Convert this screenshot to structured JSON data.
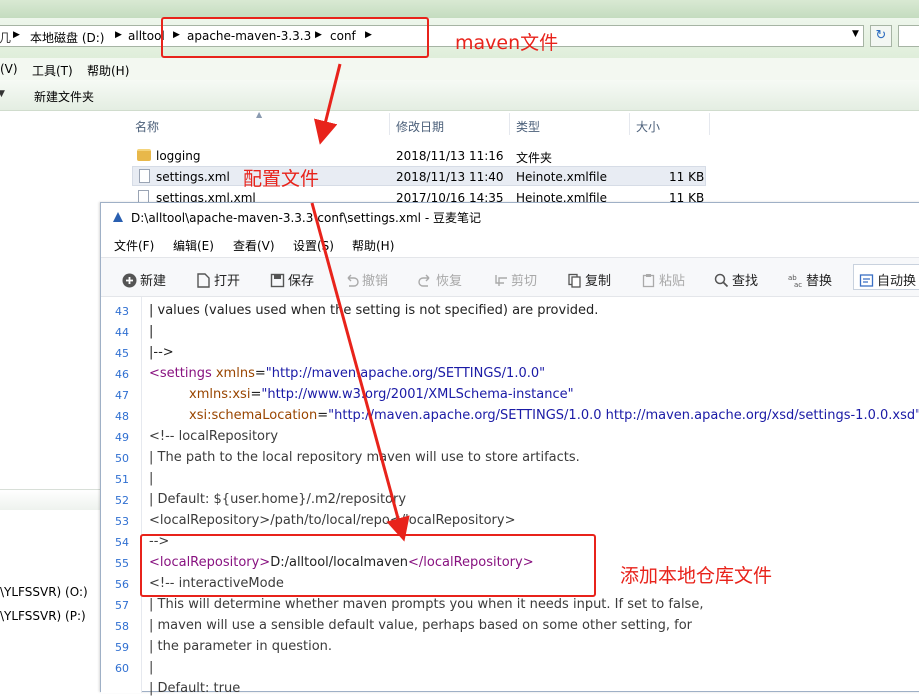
{
  "explorer": {
    "breadcrumbs": [
      "本地磁盘 (D:)",
      "alltool",
      "apache-maven-3.3.3",
      "conf"
    ],
    "menu": [
      "(V)",
      "工具(T)",
      "帮助(H)"
    ],
    "toolbar": {
      "new_folder": "新建文件夹"
    },
    "columns": {
      "name": "名称",
      "modified": "修改日期",
      "type": "类型",
      "size": "大小"
    },
    "files": [
      {
        "name": "logging",
        "modified": "2018/11/13 11:16",
        "type": "文件夹",
        "size": "",
        "kind": "folder"
      },
      {
        "name": "settings.xml",
        "modified": "2018/11/13 11:40",
        "type": "Heinote.xmlfile",
        "size": "11 KB",
        "kind": "file",
        "selected": true
      },
      {
        "name": "settings.xml.xml",
        "modified": "2017/10/16 14:35",
        "type": "Heinote.xmlfile",
        "size": "11 KB",
        "kind": "file"
      }
    ],
    "drives": [
      "\\YLFSSVR) (O:)",
      "\\YLFSSVR) (P:)"
    ]
  },
  "editor": {
    "title": "D:\\alltool\\apache-maven-3.3.3\\conf\\settings.xml - 豆麦笔记",
    "menu": [
      "文件(F)",
      "编辑(E)",
      "查看(V)",
      "设置(S)",
      "帮助(H)"
    ],
    "toolbar": {
      "new": "新建",
      "open": "打开",
      "save": "保存",
      "undo": "撤销",
      "redo": "恢复",
      "cut": "剪切",
      "copy": "复制",
      "paste": "粘贴",
      "find": "查找",
      "replace": "替换",
      "autorun": "自动换"
    },
    "line_numbers": [
      "43",
      "44",
      "45",
      "46",
      "47",
      "48",
      "49",
      "50",
      "51",
      "52",
      "53",
      "54",
      "55",
      "56",
      "57",
      "58",
      "59",
      "60"
    ],
    "lines": {
      "l43": " | values (values used when the setting is not specified) are provided.",
      "l44": " |",
      "l45": " |-->",
      "l46_tag": "<settings",
      "l46_attr": " xmlns",
      "l46_eq": "=",
      "l46_val": "\"http://maven.apache.org/SETTINGS/1.0.0\"",
      "l47_attr": "xmlns:xsi",
      "l47_eq": "=",
      "l47_val": "\"http://www.w3.org/2001/XMLSchema-instance\"",
      "l48_attr": "xsi:schemaLocation",
      "l48_eq": "=",
      "l48_val": "\"http://maven.apache.org/SETTINGS/1.0.0 http://maven.apache.org/xsd/settings-1.0.0.xsd\"",
      "l48_close": ">",
      "l49": "  <!-- localRepository",
      "l50": "   | The path to the local repository maven will use to store artifacts.",
      "l51": "   |",
      "l52": "   | Default: ${user.home}/.m2/repository",
      "l53": "  <localRepository>/path/to/local/repo</localRepository>",
      "l54": "  -->",
      "l55_open": "<localRepository>",
      "l55_text": "D:/alltool/localmaven",
      "l55_close": "</localRepository>",
      "l56": "  <!-- interactiveMode",
      "l57": "   | This will determine whether maven prompts you when it needs input. If set to false,",
      "l58": "   | maven will use a sensible default value, perhaps based on some other setting, for",
      "l59": "   | the parameter in question.",
      "l60": "   |",
      "l61": "   | Default: true"
    }
  },
  "annotations": {
    "maven_folder": "maven文件",
    "config_file": "配置文件",
    "add_local_repo": "添加本地仓库文件",
    "color": "#e8231b"
  }
}
